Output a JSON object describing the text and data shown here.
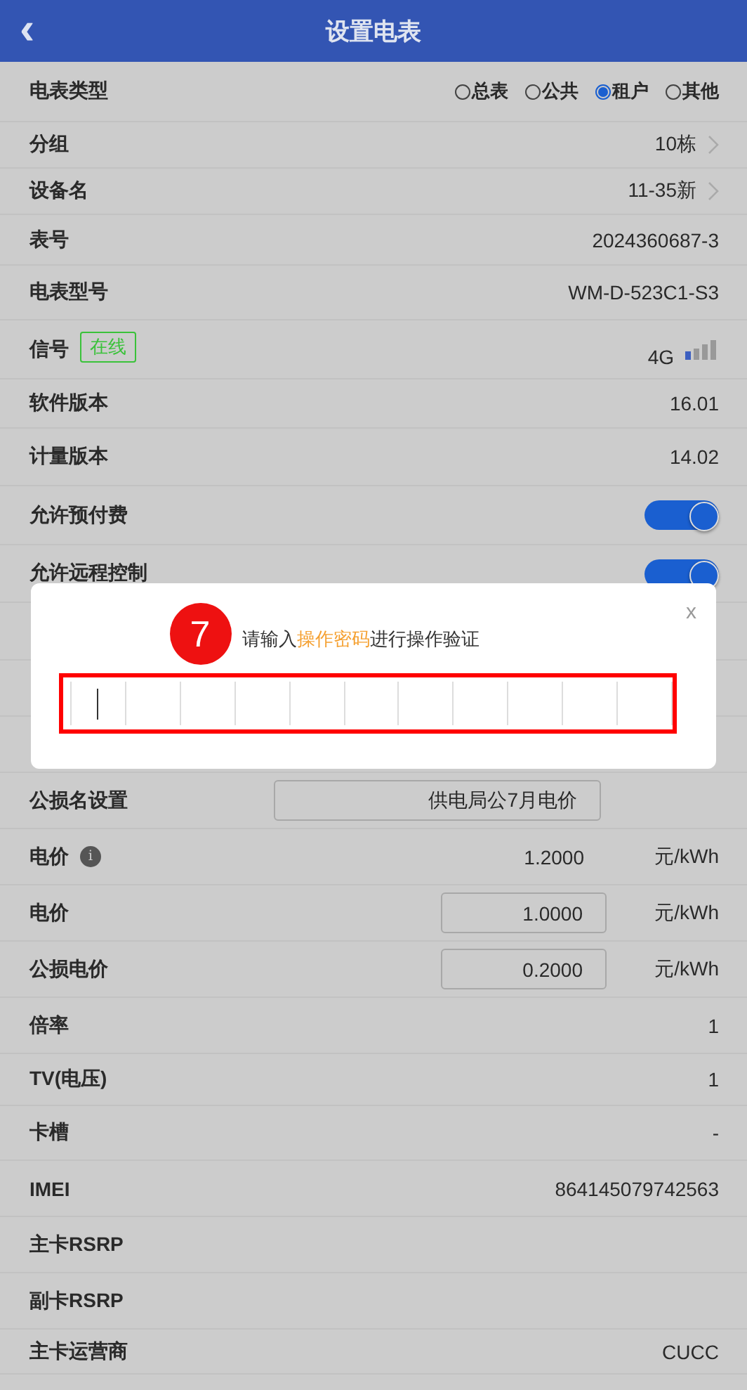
{
  "header": {
    "back": "‹",
    "title": "设置电表"
  },
  "meter_type": {
    "label": "电表类型",
    "options": [
      {
        "label": "总表",
        "selected": false
      },
      {
        "label": "公共",
        "selected": false
      },
      {
        "label": "租户",
        "selected": true
      },
      {
        "label": "其他",
        "selected": false
      }
    ]
  },
  "rows_top": [
    {
      "kind": "link",
      "label": "分组",
      "value": "10栋"
    },
    {
      "kind": "link",
      "label": "设备名",
      "value": "11-35新"
    },
    {
      "kind": "text",
      "label": "表号",
      "value": "2024360687-3"
    },
    {
      "kind": "text",
      "label": "电表型号",
      "value": "WM-D-523C1-S3"
    },
    {
      "kind": "signal",
      "label": "信号",
      "badge": "在线",
      "value": "4G"
    },
    {
      "kind": "text",
      "label": "软件版本",
      "value": "16.01"
    },
    {
      "kind": "text",
      "label": "计量版本",
      "value": "14.02"
    },
    {
      "kind": "toggle",
      "label": "允许预付费",
      "on": true
    },
    {
      "kind": "toggle",
      "label": "允许远程控制",
      "on": true
    }
  ],
  "dialog": {
    "step": "7",
    "prompt": "请输入**操作密码**进行操作验证",
    "close": "x"
  },
  "rows_bottom": [
    {
      "kind": "wideinput",
      "label": "公损名设置",
      "value": "供电局公7月电价"
    },
    {
      "kind": "price",
      "label": "电价",
      "info": "i",
      "value": "1.2000",
      "unit": "元/kWh"
    },
    {
      "kind": "priceinput",
      "label": "电价",
      "value": "1.0000",
      "unit": "元/kWh"
    },
    {
      "kind": "priceinput",
      "label": "公损电价",
      "value": "0.2000",
      "unit": "元/kWh"
    },
    {
      "kind": "text",
      "label": "倍率",
      "value": "1"
    },
    {
      "kind": "text",
      "label": "TV(电压)",
      "value": "1"
    },
    {
      "kind": "text",
      "label": "卡槽",
      "value": "-"
    },
    {
      "kind": "text",
      "label": "IMEI",
      "value": "864145079742563"
    },
    {
      "kind": "text",
      "label": "主卡RSRP"
    },
    {
      "kind": "text",
      "label": "副卡RSRP"
    },
    {
      "kind": "text",
      "label": "主卡运营商",
      "value": "CUCC"
    }
  ]
}
